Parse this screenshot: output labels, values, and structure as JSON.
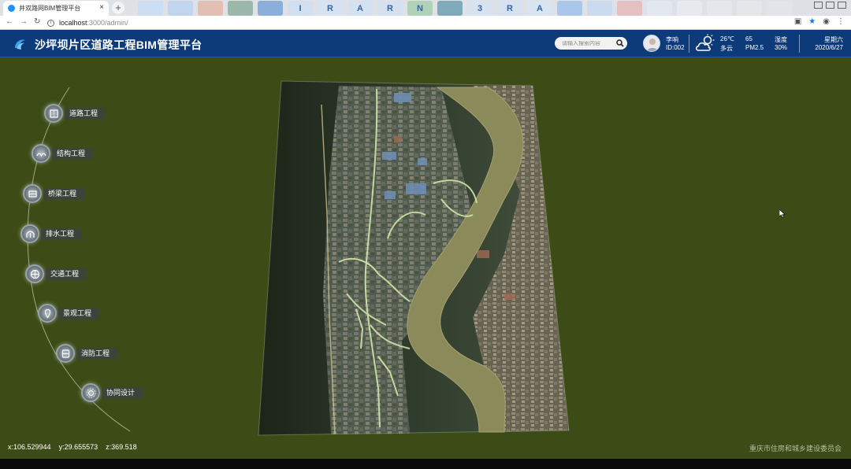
{
  "browser": {
    "tab_title": "井双路网BIM管理平台",
    "tab_close": "×",
    "new_tab": "+",
    "url_host": "localhost",
    "url_path": ":3000/admin/",
    "bookmark_letters": [
      "",
      "",
      "",
      "",
      "",
      "I",
      "R",
      "A",
      "R",
      "N",
      "",
      "3",
      "R",
      "A",
      "",
      "",
      "",
      "",
      "",
      "",
      "",
      ""
    ]
  },
  "header": {
    "title": "沙坪坝片区道路工程BIM管理平台",
    "search_placeholder": "请输入搜索内容",
    "user_name": "李响",
    "user_id": "ID:002",
    "temperature": "26℃",
    "condition": "多云",
    "pm_value": "65",
    "pm_label": "PM2.5",
    "humidity_label": "湿度",
    "humidity_value": "30%",
    "weekday": "星期六",
    "date": "2020/6/27"
  },
  "menu": {
    "items": [
      {
        "label": "道路工程",
        "icon": "road-icon"
      },
      {
        "label": "结构工程",
        "icon": "structure-icon"
      },
      {
        "label": "桥梁工程",
        "icon": "bridge-icon"
      },
      {
        "label": "排水工程",
        "icon": "drainage-icon"
      },
      {
        "label": "交通工程",
        "icon": "traffic-icon"
      },
      {
        "label": "景观工程",
        "icon": "landscape-icon"
      },
      {
        "label": "消防工程",
        "icon": "fire-icon"
      },
      {
        "label": "协同设计",
        "icon": "collaboration-icon"
      }
    ]
  },
  "status": {
    "x": "x:106.529944",
    "y": "y:29.655573",
    "z": "z:369.518",
    "credit": "重庆市住房和城乡建设委员会"
  },
  "colors": {
    "header_bg": "#0d3a78",
    "scene_bg": "#3d4b16",
    "river": "#8a8a5a"
  }
}
